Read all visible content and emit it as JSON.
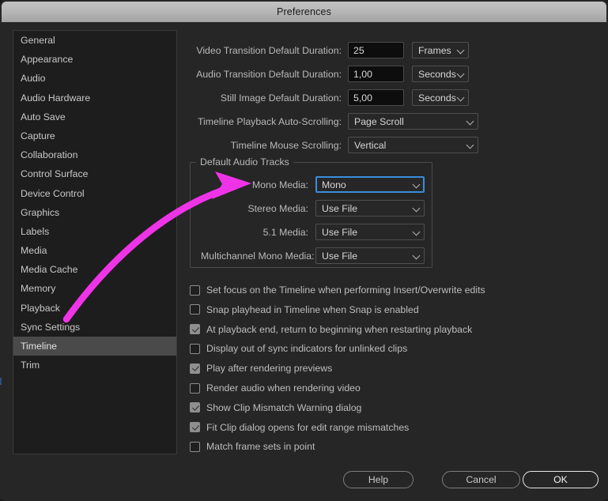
{
  "window": {
    "title": "Preferences"
  },
  "sidebar": {
    "items": [
      {
        "label": "General",
        "selected": false
      },
      {
        "label": "Appearance",
        "selected": false
      },
      {
        "label": "Audio",
        "selected": false
      },
      {
        "label": "Audio Hardware",
        "selected": false
      },
      {
        "label": "Auto Save",
        "selected": false
      },
      {
        "label": "Capture",
        "selected": false
      },
      {
        "label": "Collaboration",
        "selected": false
      },
      {
        "label": "Control Surface",
        "selected": false
      },
      {
        "label": "Device Control",
        "selected": false
      },
      {
        "label": "Graphics",
        "selected": false
      },
      {
        "label": "Labels",
        "selected": false
      },
      {
        "label": "Media",
        "selected": false
      },
      {
        "label": "Media Cache",
        "selected": false
      },
      {
        "label": "Memory",
        "selected": false
      },
      {
        "label": "Playback",
        "selected": false
      },
      {
        "label": "Sync Settings",
        "selected": false
      },
      {
        "label": "Timeline",
        "selected": true
      },
      {
        "label": "Trim",
        "selected": false
      }
    ]
  },
  "main": {
    "duration_rows": [
      {
        "label": "Video Transition Default Duration:",
        "value": "25",
        "unit": "Frames"
      },
      {
        "label": "Audio Transition Default Duration:",
        "value": "1,00",
        "unit": "Seconds"
      },
      {
        "label": "Still Image Default Duration:",
        "value": "5,00",
        "unit": "Seconds"
      }
    ],
    "scroll_rows": [
      {
        "label": "Timeline Playback Auto-Scrolling:",
        "value": "Page Scroll"
      },
      {
        "label": "Timeline Mouse Scrolling:",
        "value": "Vertical"
      }
    ],
    "audio_group": {
      "legend": "Default Audio Tracks",
      "rows": [
        {
          "label": "Mono Media:",
          "value": "Mono",
          "focused": true
        },
        {
          "label": "Stereo Media:",
          "value": "Use File",
          "focused": false
        },
        {
          "label": "5.1 Media:",
          "value": "Use File",
          "focused": false
        },
        {
          "label": "Multichannel Mono Media:",
          "value": "Use File",
          "focused": false
        }
      ]
    },
    "checkboxes": [
      {
        "label": "Set focus on the Timeline when performing Insert/Overwrite edits",
        "checked": false
      },
      {
        "label": "Snap playhead in Timeline when Snap is enabled",
        "checked": false
      },
      {
        "label": "At playback end, return to beginning when restarting playback",
        "checked": true
      },
      {
        "label": "Display out of sync indicators for unlinked clips",
        "checked": false
      },
      {
        "label": "Play after rendering previews",
        "checked": true
      },
      {
        "label": "Render audio when rendering video",
        "checked": false
      },
      {
        "label": "Show Clip Mismatch Warning dialog",
        "checked": true
      },
      {
        "label": "Fit Clip dialog opens for edit range mismatches",
        "checked": true
      },
      {
        "label": "Match frame sets in point",
        "checked": false
      }
    ]
  },
  "footer": {
    "help_label": "Help",
    "cancel_label": "Cancel",
    "ok_label": "OK"
  },
  "annotation": {
    "arrow_color": "#ef34e8"
  }
}
